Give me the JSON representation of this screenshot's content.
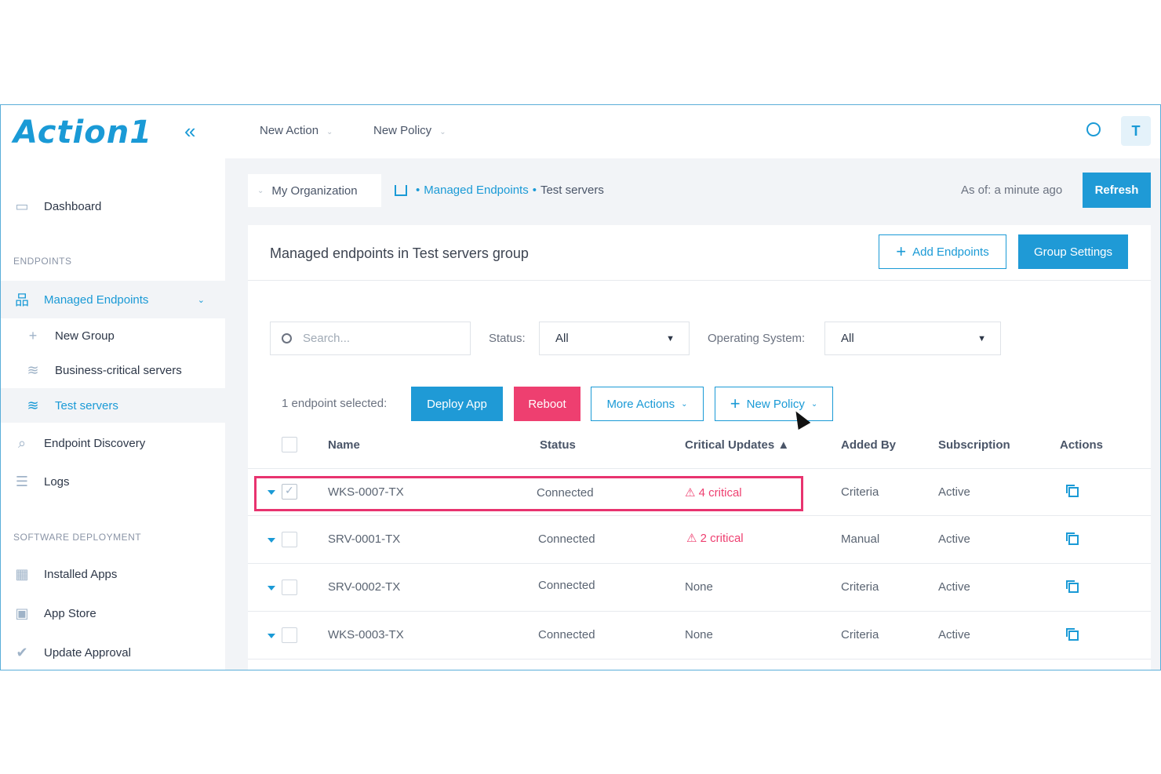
{
  "app": {
    "logo": "Action1"
  },
  "topbar": {
    "new_action": "New Action",
    "new_policy": "New Policy",
    "avatar": "T"
  },
  "sidebar": {
    "dashboard": "Dashboard",
    "section_endpoints": "ENDPOINTS",
    "managed_endpoints": "Managed Endpoints",
    "new_group": "New Group",
    "business_critical": "Business-critical servers",
    "test_servers": "Test servers",
    "endpoint_discovery": "Endpoint Discovery",
    "logs": "Logs",
    "section_software": "SOFTWARE DEPLOYMENT",
    "installed_apps": "Installed Apps",
    "app_store": "App Store",
    "update_approval": "Update Approval"
  },
  "breadcrumb": {
    "org": "My Organization",
    "managed": "Managed Endpoints",
    "current": "Test servers",
    "as_of": "As of: a minute ago",
    "refresh": "Refresh"
  },
  "panel": {
    "title": "Managed endpoints in Test servers group",
    "add_endpoints": "Add Endpoints",
    "group_settings": "Group Settings",
    "search_placeholder": "Search...",
    "status_label": "Status:",
    "status_value": "All",
    "os_label": "Operating System:",
    "os_value": "All",
    "selected_text": "1 endpoint selected:",
    "deploy_app": "Deploy App",
    "reboot": "Reboot",
    "more_actions": "More Actions",
    "new_policy": "New Policy"
  },
  "table": {
    "headers": {
      "name": "Name",
      "status": "Status",
      "critical": "Critical Updates ▲",
      "added_by": "Added By",
      "subscription": "Subscription",
      "actions": "Actions"
    },
    "rows": [
      {
        "name": "WKS-0007-TX",
        "status": "Connected",
        "critical": "4 critical",
        "added_by": "Criteria",
        "subscription": "Active"
      },
      {
        "name": "SRV-0001-TX",
        "status": "Connected",
        "critical": "2 critical",
        "added_by": "Manual",
        "subscription": "Active"
      },
      {
        "name": "SRV-0002-TX",
        "status": "Connected",
        "critical": "None",
        "added_by": "Criteria",
        "subscription": "Active"
      },
      {
        "name": "WKS-0003-TX",
        "status": "Connected",
        "critical": "None",
        "added_by": "Criteria",
        "subscription": "Active"
      }
    ]
  }
}
